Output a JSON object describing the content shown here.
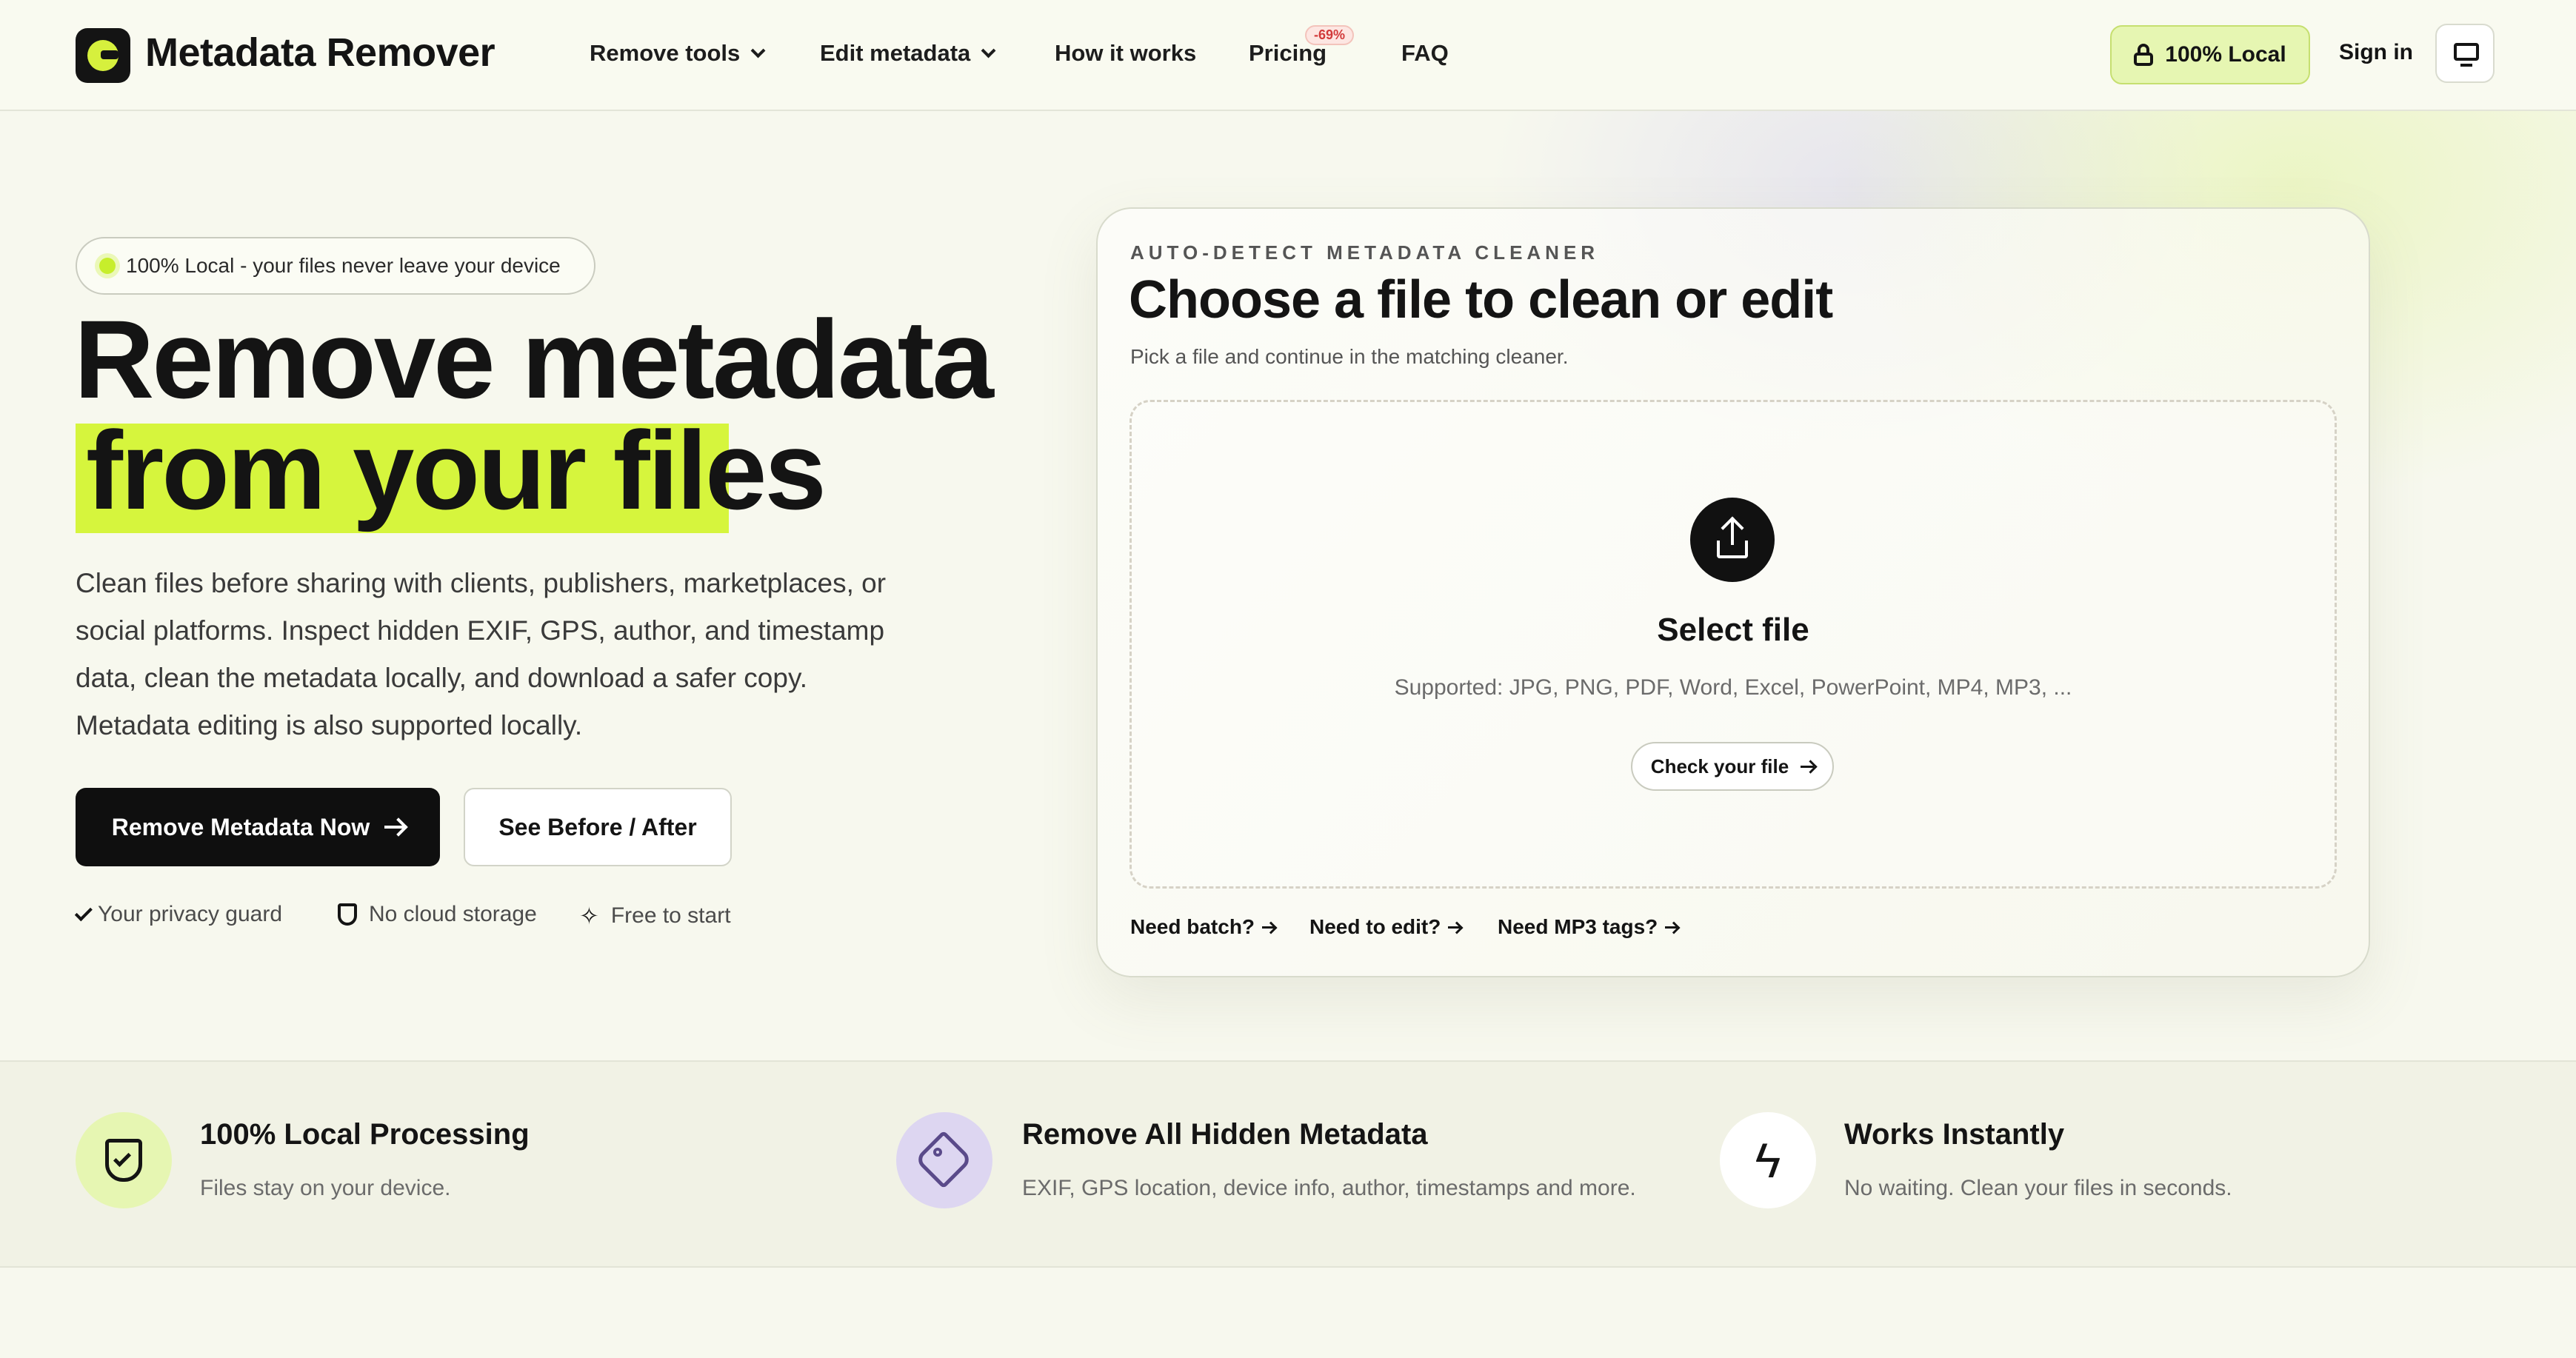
{
  "nav": {
    "brand": "Metadata Remover",
    "items": [
      {
        "label": "Remove tools"
      },
      {
        "label": "Edit metadata"
      },
      {
        "label": "How it works"
      },
      {
        "label": "Pricing"
      },
      {
        "label": "FAQ"
      }
    ],
    "pricing_badge": "-69%",
    "local_label": "100% Local",
    "signin_label": "Sign in"
  },
  "hero": {
    "pill": "100% Local - your files never leave your device",
    "title_line1": "Remove metadata",
    "title_line2": "from your files",
    "lead": "Clean files before sharing with clients, publishers, marketplaces, or social platforms. Inspect hidden EXIF, GPS, author, and timestamp data, clean the metadata locally, and download a safer copy. Metadata editing is also supported locally.",
    "cta_primary": "Remove Metadata Now",
    "cta_secondary": "See Before / After",
    "trust": [
      "Your privacy guard",
      "No cloud storage",
      "Free to start"
    ]
  },
  "card": {
    "eyebrow": "AUTO-DETECT METADATA CLEANER",
    "title": "Choose a file to clean or edit",
    "subtitle": "Pick a file and continue in the matching cleaner.",
    "select_label": "Select file",
    "supported": "Supported: JPG, PNG, PDF, Word, Excel, PowerPoint, MP4, MP3, ...",
    "check_label": "Check your file",
    "links": [
      "Need batch?",
      "Need to edit?",
      "Need MP3 tags?"
    ]
  },
  "features": [
    {
      "title": "100% Local Processing",
      "desc": "Files stay on your device.",
      "icon": "shield-check-icon",
      "color": "#e6f6b2"
    },
    {
      "title": "Remove All Hidden Metadata",
      "desc": "EXIF, GPS location, device info, author, timestamps and more.",
      "icon": "tag-icon",
      "color": "#ddd6f1"
    },
    {
      "title": "Works Instantly",
      "desc": "No waiting. Clean your files in seconds.",
      "icon": "bolt-icon",
      "color": "#ffffff"
    }
  ],
  "colors": {
    "accent": "#d6f53d",
    "dark": "#0f0f0f"
  }
}
